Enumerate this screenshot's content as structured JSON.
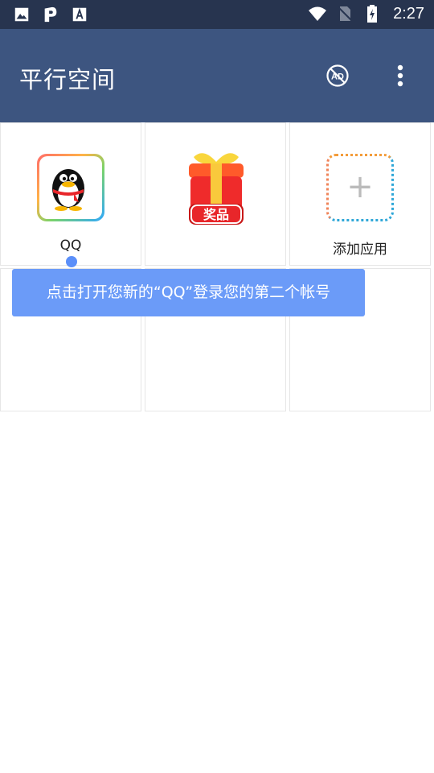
{
  "status_bar": {
    "time": "2:27",
    "icons": [
      "gallery-icon",
      "p-app-icon",
      "font-app-icon",
      "wifi-icon",
      "no-sim-icon",
      "battery-charging-icon"
    ]
  },
  "app_bar": {
    "title": "平行空间",
    "actions": [
      "ad-block-icon",
      "more-vert-icon"
    ]
  },
  "apps": [
    {
      "label": "QQ",
      "icon": "qq-penguin-icon"
    },
    {
      "label": "",
      "icon": "gift-prize-icon",
      "badge_text": "奖品"
    },
    {
      "label": "添加应用",
      "icon": "add-icon",
      "symbol": "+"
    }
  ],
  "tooltip": {
    "text": "点击打开您新的“QQ”登录您的第二个帐号"
  },
  "colors": {
    "status_bar": "#27344f",
    "app_bar": "#3d5580",
    "tooltip": "#6b9bf8"
  }
}
